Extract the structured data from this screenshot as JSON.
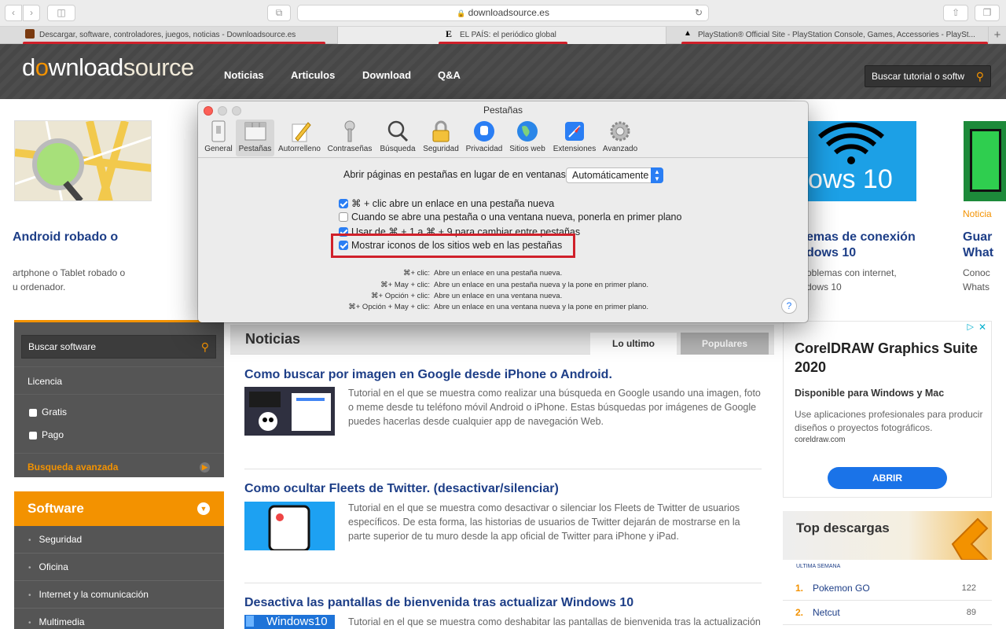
{
  "browser": {
    "url": "downloadsource.es",
    "tabs": [
      {
        "title": "Descargar, software, controladores, juegos, noticias - Downloadsource.es"
      },
      {
        "title": "EL PAÍS: el periódico global"
      },
      {
        "title": "PlayStation® Official Site - PlayStation Console, Games, Accessories - PlaySt..."
      }
    ]
  },
  "site": {
    "logo_prefix": "d",
    "logo_o": "o",
    "logo_mid": "wnload",
    "logo_suffix": "source",
    "nav": [
      "Noticias",
      "Articulos",
      "Download",
      "Q&A"
    ],
    "search_placeholder": "Buscar tutorial o softw"
  },
  "strip": {
    "left_title": "Android robado o",
    "left_desc_1": "artphone o Tablet robado o",
    "left_desc_2": "u ordenador.",
    "right_thumb_text": "ows 10",
    "right_title_1": "emas de conexión",
    "right_title_2": "dows 10",
    "right_desc_1": "oblemas con internet,",
    "right_desc_2": "dows 10",
    "far_cat": "Noticia",
    "far_title_1": "Guar",
    "far_title_2": "What",
    "far_desc_1": "Conoc",
    "far_desc_2": "Whats"
  },
  "sidebar": {
    "search_placeholder": "Buscar software",
    "licencia": "Licencia",
    "gratis": "Gratis",
    "pago": "Pago",
    "advanced": "Busqueda avanzada",
    "software_title": "Software",
    "items": [
      "Seguridad",
      "Oficina",
      "Internet y la comunicación",
      "Multimedia"
    ]
  },
  "news": {
    "title": "Noticias",
    "tab_latest": "Lo ultimo",
    "tab_popular": "Populares",
    "articles": [
      {
        "title": "Como buscar por imagen en Google desde iPhone o Android.",
        "desc": "Tutorial en el que se muestra como realizar una búsqueda en Google usando una imagen, foto o meme desde tu teléfono móvil Android o iPhone. Estas búsquedas por imágenes de Google puedes hacerlas desde cualquier app de navegación Web."
      },
      {
        "title": "Como ocultar Fleets de Twitter. (desactivar/silenciar)",
        "desc": "Tutorial en el que se muestra como desactivar o silenciar los Fleets de Twitter de usuarios específicos. De esta forma, las historias de usuarios de Twitter dejarán de mostrarse en la parte superior de tu muro desde la app oficial de Twitter para iPhone y iPad."
      },
      {
        "title": "Desactiva las pantallas de bienvenida tras actualizar Windows 10",
        "desc": "Tutorial en el que se muestra como deshabitar las pantallas de bienvenida tras la actualización",
        "thumb_text": "Windows10"
      }
    ]
  },
  "ad": {
    "headline": "CorelDRAW Graphics Suite 2020",
    "sub": "Disponible para Windows y Mac",
    "desc": "Use aplicaciones profesionales para producir diseños o proyectos fotográficos.",
    "domain": "coreldraw.com",
    "cta": "ABRIR"
  },
  "top": {
    "title": "Top descargas",
    "period": "ULTIMA SEMANA",
    "rows": [
      {
        "rank": "1.",
        "name": "Pokemon GO",
        "count": "122"
      },
      {
        "rank": "2.",
        "name": "Netcut",
        "count": "89"
      }
    ]
  },
  "dialog": {
    "title": "Pestañas",
    "prefs": [
      "General",
      "Pestañas",
      "Autorrelleno",
      "Contraseñas",
      "Búsqueda",
      "Seguridad",
      "Privacidad",
      "Sitios web",
      "Extensiones",
      "Avanzado"
    ],
    "open_label": "Abrir páginas en pestañas en lugar de en ventanas:",
    "open_value": "Automáticamente",
    "options": [
      {
        "label": "⌘ + clic abre un enlace en una pestaña nueva",
        "checked": true
      },
      {
        "label": "Cuando se abre una pestaña o una ventana nueva, ponerla en primer plano",
        "checked": false
      },
      {
        "label": "Usar de ⌘ + 1 a ⌘ + 9 para cambiar entre pestañas",
        "checked": true
      },
      {
        "label": "Mostrar iconos de los sitios web en las pestañas",
        "checked": true
      }
    ],
    "shortcuts": [
      {
        "keys": "⌘+ clic:",
        "desc": "Abre un enlace en una pestaña nueva."
      },
      {
        "keys": "⌘+ May + clic:",
        "desc": "Abre un enlace en una pestaña nueva y la pone en primer plano."
      },
      {
        "keys": "⌘+ Opción + clic:",
        "desc": "Abre un enlace en una ventana nueva."
      },
      {
        "keys": "⌘+ Opción + May + clic:",
        "desc": "Abre un enlace en una ventana nueva y la pone en primer plano."
      }
    ],
    "help": "?"
  },
  "colors": {
    "accent": "#f39200",
    "link": "#1d3e87",
    "highlight": "#d0202a",
    "mac_blue": "#2a7ef4"
  }
}
